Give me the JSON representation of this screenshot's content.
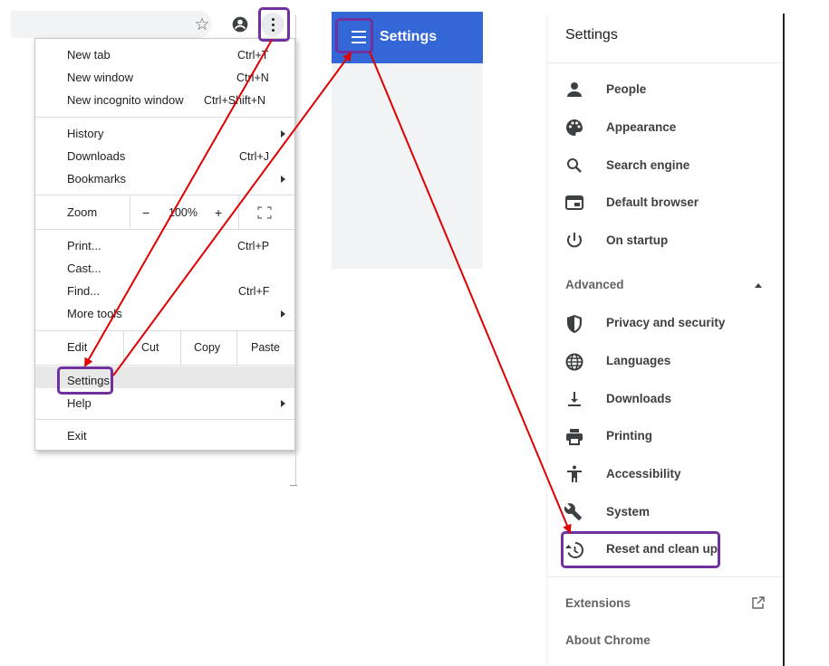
{
  "chrome_menu": {
    "items": {
      "new_tab": "New tab",
      "new_tab_shortcut": "Ctrl+T",
      "new_window": "New window",
      "new_window_shortcut": "Ctrl+N",
      "new_incognito": "New incognito window",
      "new_incognito_shortcut": "Ctrl+Shift+N",
      "history": "History",
      "downloads": "Downloads",
      "downloads_shortcut": "Ctrl+J",
      "bookmarks": "Bookmarks",
      "zoom": "Zoom",
      "zoom_minus": "−",
      "zoom_level": "100%",
      "zoom_plus": "+",
      "print": "Print...",
      "print_shortcut": "Ctrl+P",
      "cast": "Cast...",
      "find": "Find...",
      "find_shortcut": "Ctrl+F",
      "more_tools": "More tools",
      "edit": "Edit",
      "cut": "Cut",
      "copy": "Copy",
      "paste": "Paste",
      "settings": "Settings",
      "help": "Help",
      "exit": "Exit"
    }
  },
  "settings_header": {
    "title": "Settings"
  },
  "settings_sidebar": {
    "title": "Settings",
    "items": [
      {
        "label": "People",
        "icon": "person-icon"
      },
      {
        "label": "Appearance",
        "icon": "palette-icon"
      },
      {
        "label": "Search engine",
        "icon": "search-icon"
      },
      {
        "label": "Default browser",
        "icon": "browser-icon"
      },
      {
        "label": "On startup",
        "icon": "power-icon"
      }
    ],
    "advanced_label": "Advanced",
    "advanced_items": [
      {
        "label": "Privacy and security",
        "icon": "shield-icon"
      },
      {
        "label": "Languages",
        "icon": "globe-icon"
      },
      {
        "label": "Downloads",
        "icon": "download-icon"
      },
      {
        "label": "Printing",
        "icon": "printer-icon"
      },
      {
        "label": "Accessibility",
        "icon": "accessibility-icon"
      },
      {
        "label": "System",
        "icon": "wrench-icon"
      },
      {
        "label": "Reset and clean up",
        "icon": "restore-icon"
      }
    ],
    "extensions": "Extensions",
    "about": "About Chrome"
  },
  "colors": {
    "chrome_blue": "#3367d6",
    "highlight_purple": "#7030a0",
    "arrow_red": "#e00000"
  }
}
